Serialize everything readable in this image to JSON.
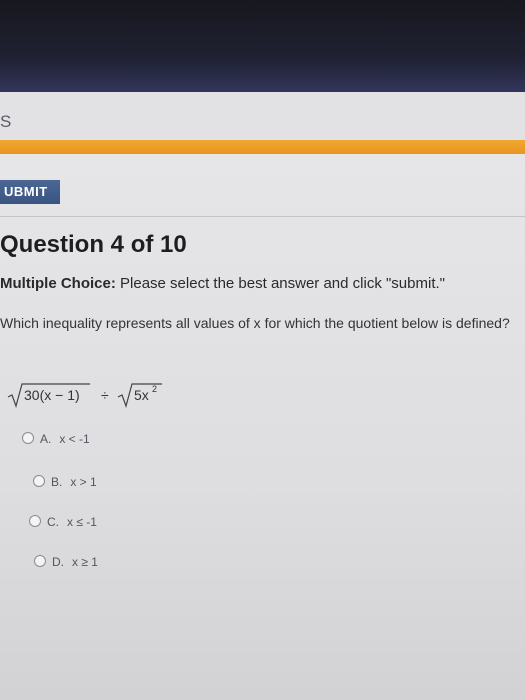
{
  "nav": {
    "fragment": "S"
  },
  "submit_label": "UBMIT",
  "question": {
    "title": "Question 4 of 10",
    "type_label": "Multiple Choice:",
    "instruction": "Please select the best answer and click \"submit.\"",
    "prompt": "Which inequality represents all values of x for which the quotient below is defined?",
    "expression": {
      "left_radicand": "30(x − 1)",
      "operator": "÷",
      "right_radicand_base": "5x",
      "right_radicand_exponent": "2"
    }
  },
  "choices": [
    {
      "letter": "A.",
      "text": "x < -1"
    },
    {
      "letter": "B.",
      "text": "x > 1"
    },
    {
      "letter": "C.",
      "text": "x ≤ -1"
    },
    {
      "letter": "D.",
      "text": "x ≥ 1"
    }
  ],
  "colors": {
    "top_bar": "#1e2030",
    "accent_orange": "#f0a830",
    "submit_blue": "#4d6794"
  }
}
